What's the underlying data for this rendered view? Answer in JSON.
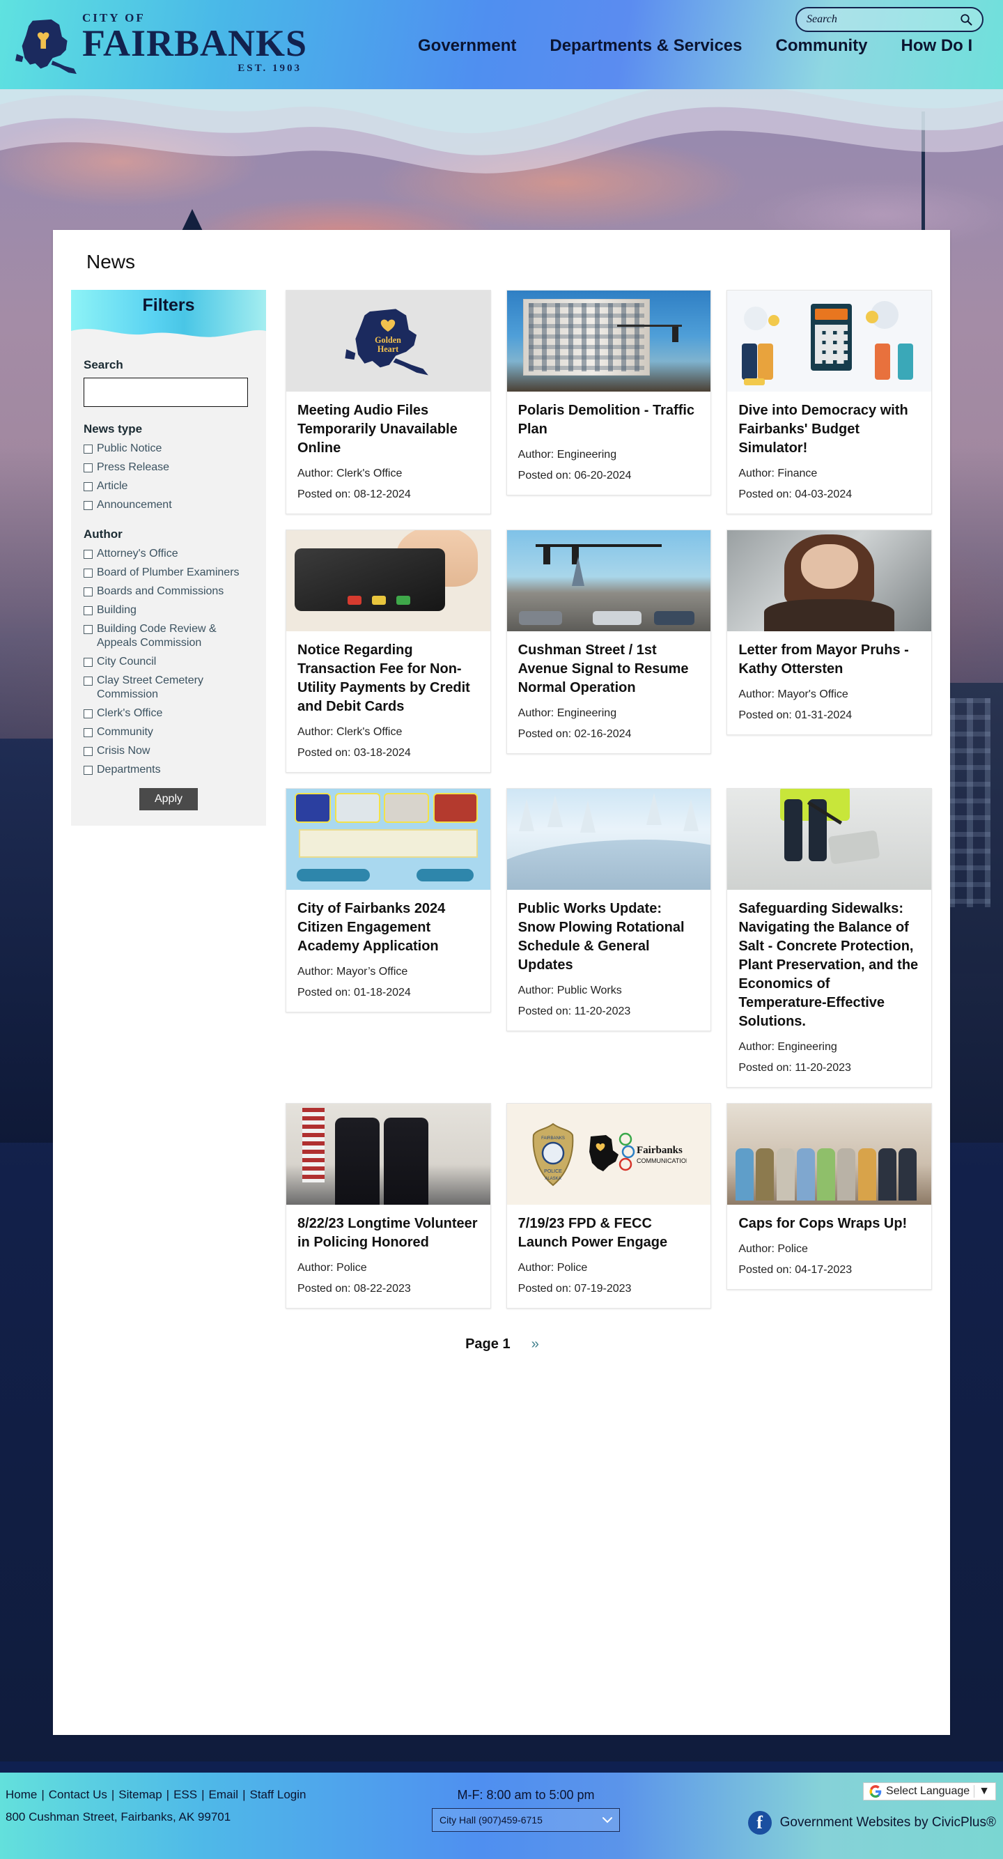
{
  "header": {
    "logo": {
      "city_of": "CITY OF",
      "name": "FAIRBANKS",
      "est": "EST. 1903",
      "map_icon": "alaska-map-icon"
    },
    "nav": [
      {
        "label": "Government"
      },
      {
        "label": "Departments & Services"
      },
      {
        "label": "Community"
      },
      {
        "label": "How Do I"
      }
    ],
    "search": {
      "placeholder": "Search",
      "value": "",
      "icon": "search-icon"
    }
  },
  "page": {
    "title": "News"
  },
  "sidebar": {
    "title": "Filters",
    "search_label": "Search",
    "search_value": "",
    "news_type_label": "News type",
    "news_types": [
      {
        "label": "Public Notice",
        "checked": false
      },
      {
        "label": "Press Release",
        "checked": false
      },
      {
        "label": "Article",
        "checked": false
      },
      {
        "label": "Announcement",
        "checked": false
      }
    ],
    "author_label": "Author",
    "authors": [
      {
        "label": "Attorney's Office",
        "checked": false
      },
      {
        "label": "Board of Plumber Examiners",
        "checked": false
      },
      {
        "label": "Boards and Commissions",
        "checked": false
      },
      {
        "label": "Building",
        "checked": false
      },
      {
        "label": "Building Code Review & Appeals Commission",
        "checked": false
      },
      {
        "label": "City Council",
        "checked": false
      },
      {
        "label": "Clay Street Cemetery Commission",
        "checked": false
      },
      {
        "label": "Clerk's Office",
        "checked": false
      },
      {
        "label": "Community",
        "checked": false
      },
      {
        "label": "Crisis Now",
        "checked": false
      },
      {
        "label": "Departments",
        "checked": false
      }
    ],
    "apply_label": "Apply"
  },
  "news": {
    "author_prefix": "Author: ",
    "posted_prefix": "Posted on: ",
    "cards": [
      {
        "title": "Meeting Audio Files Temporarily Unavailable Online",
        "author": "Author: Clerk's Office",
        "posted": "Posted on: 08-12-2024",
        "image": "golden-heart-alaska-logo"
      },
      {
        "title": "Polaris Demolition - Traffic Plan",
        "author": "Author: Engineering",
        "posted": "Posted on: 06-20-2024",
        "image": "polaris-building-photo"
      },
      {
        "title": "Dive into Democracy with Fairbanks' Budget Simulator!",
        "author": "Author: Finance",
        "posted": "Posted on: 04-03-2024",
        "image": "calculator-illustration"
      },
      {
        "title": "Notice Regarding Transaction Fee for Non-Utility Payments by Credit and Debit Cards",
        "author": "Author: Clerk's Office",
        "posted": "Posted on: 03-18-2024",
        "image": "card-terminal-photo"
      },
      {
        "title": "Cushman Street / 1st Avenue Signal to Resume Normal Operation",
        "author": "Author: Engineering",
        "posted": "Posted on: 02-16-2024",
        "image": "cushman-street-photo"
      },
      {
        "title": "Letter from Mayor Pruhs - Kathy Ottersten",
        "author": "Author: Mayor's Office",
        "posted": "Posted on: 01-31-2024",
        "image": "kathy-ottersten-portrait"
      },
      {
        "title": "City of Fairbanks 2024 Citizen Engagement Academy Application",
        "author": "Author: Mayor’s Office",
        "posted": "Posted on: 01-18-2024",
        "image": "citizen-engagement-academy-flyer"
      },
      {
        "title": "Public Works Update: Snow Plowing Rotational Schedule & General Updates",
        "author": "Author: Public Works",
        "posted": "Posted on: 11-20-2023",
        "image": "snowy-road-photo"
      },
      {
        "title": "Safeguarding Sidewalks: Navigating the Balance of Salt - Concrete Protection, Plant Preservation, and the Economics of Temperature-Effective Solutions.",
        "author": "Author: Engineering",
        "posted": "Posted on: 11-20-2023",
        "image": "shoveling-sidewalk-photo"
      },
      {
        "title": "8/22/23 Longtime Volunteer in Policing Honored",
        "author": "Author: Police",
        "posted": "Posted on: 08-22-2023",
        "image": "police-award-photo"
      },
      {
        "title": "7/19/23 FPD & FECC Launch Power Engage",
        "author": "Author: Police",
        "posted": "Posted on: 07-19-2023",
        "image": "fpd-fecc-logos"
      },
      {
        "title": "Caps for Cops Wraps Up!",
        "author": "Author: Police",
        "posted": "Posted on: 04-17-2023",
        "image": "caps-for-cops-group-photo"
      }
    ]
  },
  "pagination": {
    "page_label": "Page 1",
    "next_label": "››"
  },
  "footer": {
    "links": [
      {
        "label": "Home"
      },
      {
        "label": "Contact Us"
      },
      {
        "label": "Sitemap"
      },
      {
        "label": "ESS"
      },
      {
        "label": "Email"
      },
      {
        "label": "Staff Login"
      }
    ],
    "separator": "|",
    "address": "800 Cushman Street, Fairbanks, AK 99701",
    "hours": "M-F: 8:00 am to 5:00 pm",
    "phone_select": "City Hall (907)459-6715",
    "language_widget": {
      "label": "Select Language",
      "google_icon": "google-g-icon",
      "caret": "▼"
    },
    "credit": "Government Websites by CivicPlus®",
    "facebook_icon": "facebook-icon"
  }
}
